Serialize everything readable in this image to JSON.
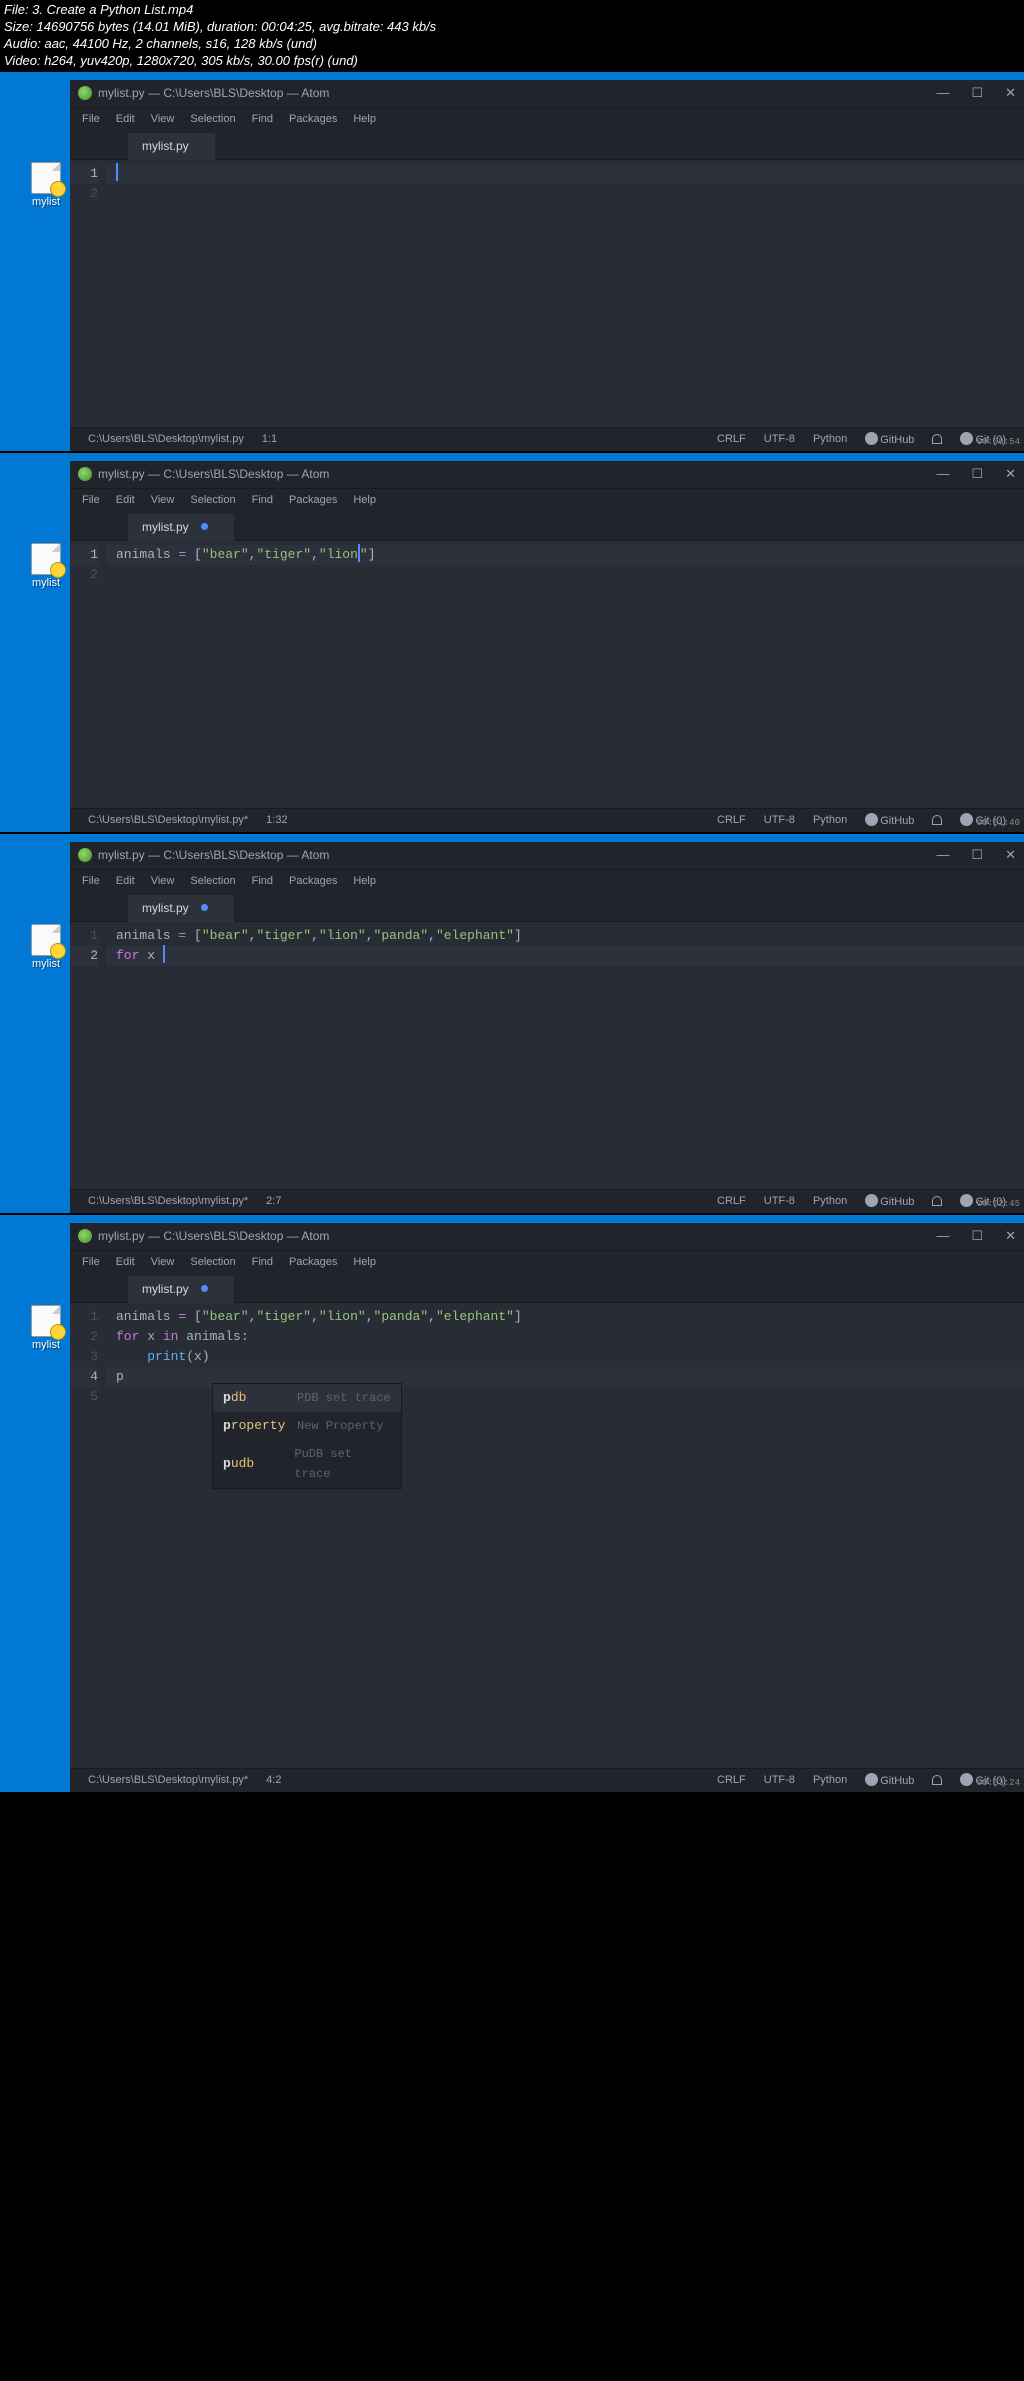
{
  "header": {
    "l1": "File: 3. Create a Python List.mp4",
    "l2": "Size: 14690756 bytes (14.01 MiB), duration: 00:04:25, avg.bitrate: 443 kb/s",
    "l3": "Audio: aac, 44100 Hz, 2 channels, s16, 128 kb/s (und)",
    "l4": "Video: h264, yuv420p, 1280x720, 305 kb/s, 30.00 fps(r) (und)"
  },
  "menu": {
    "file": "File",
    "edit": "Edit",
    "view": "View",
    "selection": "Selection",
    "find": "Find",
    "packages": "Packages",
    "help": "Help"
  },
  "desktop_icon_label": "mylist",
  "win_min": "—",
  "win_max": "☐",
  "win_close": "✕",
  "github_label": "GitHub",
  "frames": [
    {
      "title": "mylist.py — C:\\Users\\BLS\\Desktop — Atom",
      "tab": "mylist.py",
      "dirty": false,
      "lines": [
        {
          "n": "1",
          "html": "",
          "cursor": true
        },
        {
          "n": "2",
          "html": "",
          "cursor": false
        }
      ],
      "status_left": [
        "C:\\Users\\BLS\\Desktop\\mylist.py",
        "1:1"
      ],
      "status_right": [
        "CRLF",
        "UTF-8",
        "Python"
      ],
      "stamp": "00:00:54",
      "has_handle": false
    },
    {
      "title": "mylist.py — C:\\Users\\BLS\\Desktop — Atom",
      "tab": "mylist.py",
      "dirty": true,
      "lines": [
        {
          "n": "1",
          "html": "<span class='c-gr'>animals </span><span class='c-p'>=</span><span class='c-gr'> [</span><span class='c-g'>\"bear\"</span><span class='c-gr'>,</span><span class='c-g'>\"tiger\"</span><span class='c-gr'>,</span><span class='c-g'>\"lion</span><span class='cursor'></span><span class='c-g'>\"</span><span class='c-gr'>]</span>",
          "cursor": true
        },
        {
          "n": "2",
          "html": "",
          "cursor": false
        }
      ],
      "status_left": [
        "C:\\Users\\BLS\\Desktop\\mylist.py*",
        "1:32"
      ],
      "status_right": [
        "CRLF",
        "UTF-8",
        "Python"
      ],
      "stamp": "00:01:40",
      "has_handle": true
    },
    {
      "title": "mylist.py — C:\\Users\\BLS\\Desktop — Atom",
      "tab": "mylist.py",
      "dirty": true,
      "lines": [
        {
          "n": "1",
          "html": "<span class='c-gr'>animals </span><span class='c-p'>=</span><span class='c-gr'> [</span><span class='c-g'>\"bear\"</span><span class='c-gr'>,</span><span class='c-g'>\"tiger\"</span><span class='c-gr'>,</span><span class='c-g'>\"lion\"</span><span class='c-gr'>,</span><span class='c-g'>\"panda\"</span><span class='c-gr'>,</span><span class='c-g'>\"elephant\"</span><span class='c-gr'>]</span>",
          "cursor": false
        },
        {
          "n": "2",
          "html": "<span class='c-p'>for</span><span class='c-gr'> x </span><span class='cursor'></span>",
          "cursor": true
        }
      ],
      "status_left": [
        "C:\\Users\\BLS\\Desktop\\mylist.py*",
        "2:7"
      ],
      "status_right": [
        "CRLF",
        "UTF-8",
        "Python"
      ],
      "stamp": "00:02:45",
      "has_handle": false
    },
    {
      "title": "mylist.py — C:\\Users\\BLS\\Desktop — Atom",
      "tab": "mylist.py",
      "dirty": true,
      "lines": [
        {
          "n": "1",
          "html": "<span class='c-gr'>animals </span><span class='c-p'>=</span><span class='c-gr'> [</span><span class='c-g'>\"bear\"</span><span class='c-gr'>,</span><span class='c-g'>\"tiger\"</span><span class='c-gr'>,</span><span class='c-g'>\"lion\"</span><span class='c-gr'>,</span><span class='c-g'>\"panda\"</span><span class='c-gr'>,</span><span class='c-g'>\"elephant\"</span><span class='c-gr'>]</span>",
          "cursor": false
        },
        {
          "n": "2",
          "html": "<span class='c-p'>for</span><span class='c-gr'> x </span><span class='c-p'>in</span><span class='c-gr'> animals:</span>",
          "cursor": false
        },
        {
          "n": "3",
          "html": "<span class='c-gr'>    </span><span class='c-b'>print</span><span class='c-gr'>(x)</span>",
          "cursor": false
        },
        {
          "n": "4",
          "html": "<span class='c-gr'>p</span>",
          "cursor": true
        },
        {
          "n": "5",
          "html": "",
          "cursor": false
        }
      ],
      "status_left": [
        "C:\\Users\\BLS\\Desktop\\mylist.py*",
        "4:2"
      ],
      "status_right": [
        "CRLF",
        "UTF-8",
        "Python"
      ],
      "stamp": "00:03:24",
      "has_handle": false,
      "autocomplete": [
        {
          "kw": "pdb",
          "hint": "PDB set trace",
          "sel": true,
          "bold": "p"
        },
        {
          "kw": "property",
          "hint": "New Property",
          "sel": false,
          "bold": "p"
        },
        {
          "kw": "pudb",
          "hint": "PuDB set trace",
          "sel": false,
          "bold": "p"
        }
      ]
    }
  ]
}
